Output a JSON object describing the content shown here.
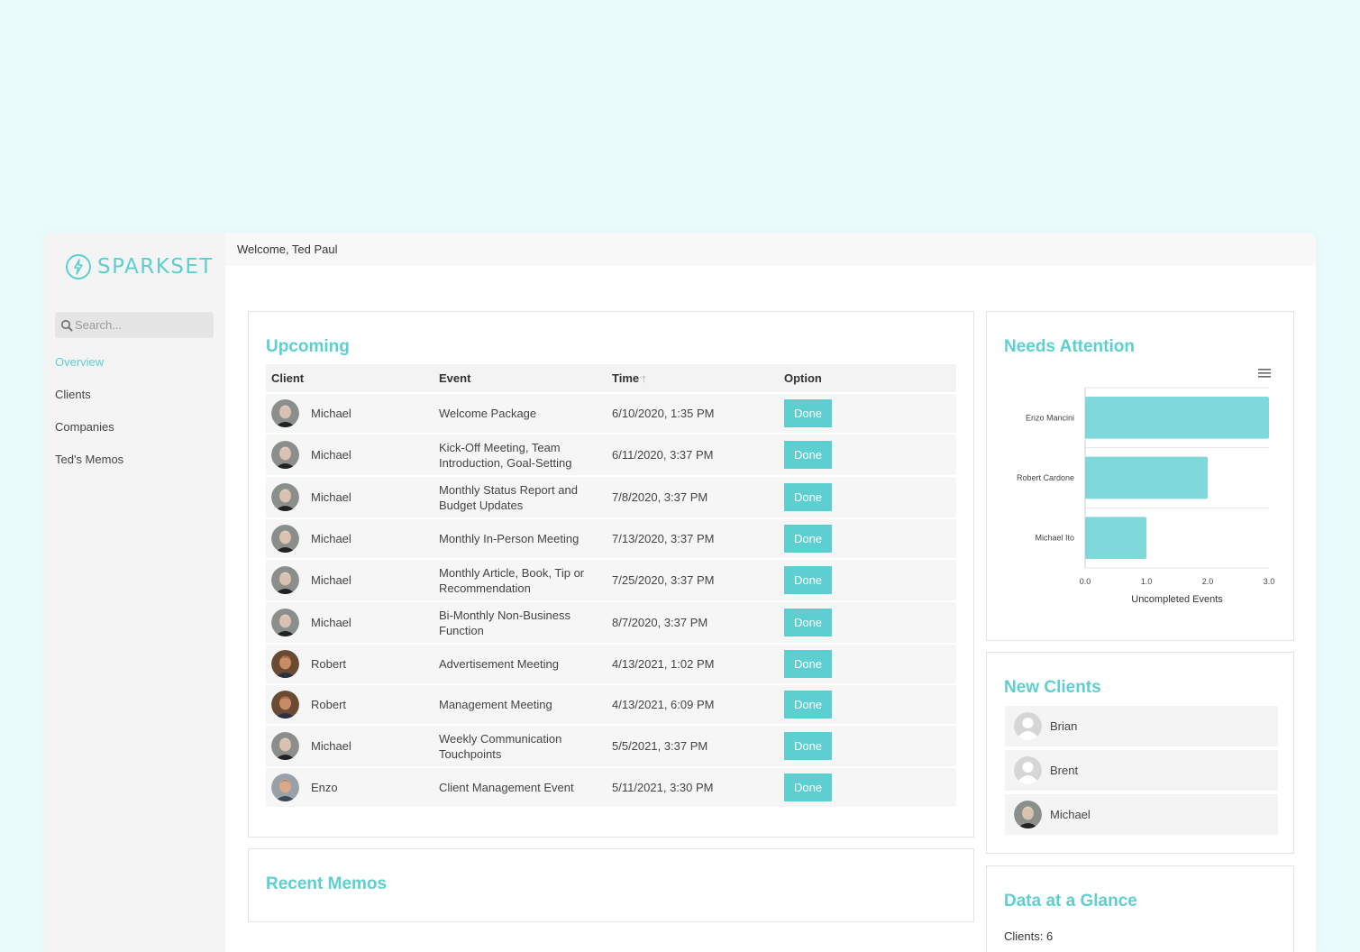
{
  "brand": {
    "name": "SPARKSET",
    "accent": "#5dcfd0"
  },
  "search": {
    "placeholder": "Search..."
  },
  "nav": {
    "items": [
      {
        "label": "Overview",
        "active": true
      },
      {
        "label": "Clients",
        "active": false
      },
      {
        "label": "Companies",
        "active": false
      },
      {
        "label": "Ted's Memos",
        "active": false
      }
    ]
  },
  "header": {
    "welcome": "Welcome, Ted Paul"
  },
  "upcoming": {
    "title": "Upcoming",
    "columns": {
      "client": "Client",
      "event": "Event",
      "time": "Time",
      "option": "Option"
    },
    "sort_icon": "arrow-up-icon",
    "rows": [
      {
        "client": "Michael",
        "event": "Welcome Package",
        "time": "6/10/2020, 1:35 PM",
        "option": "Done"
      },
      {
        "client": "Michael",
        "event": "Kick-Off Meeting, Team Introduction, Goal-Setting",
        "time": "6/11/2020, 3:37 PM",
        "option": "Done"
      },
      {
        "client": "Michael",
        "event": "Monthly Status Report and Budget Updates",
        "time": "7/8/2020, 3:37 PM",
        "option": "Done"
      },
      {
        "client": "Michael",
        "event": "Monthly In-Person Meeting",
        "time": "7/13/2020, 3:37 PM",
        "option": "Done"
      },
      {
        "client": "Michael",
        "event": "Monthly Article, Book, Tip or Recommendation",
        "time": "7/25/2020, 3:37 PM",
        "option": "Done"
      },
      {
        "client": "Michael",
        "event": "Bi-Monthly Non-Business Function",
        "time": "8/7/2020, 3:37 PM",
        "option": "Done"
      },
      {
        "client": "Robert",
        "event": "Advertisement Meeting",
        "time": "4/13/2021, 1:02 PM",
        "option": "Done"
      },
      {
        "client": "Robert",
        "event": "Management Meeting",
        "time": "4/13/2021, 6:09 PM",
        "option": "Done"
      },
      {
        "client": "Michael",
        "event": "Weekly Communication Touchpoints",
        "time": "5/5/2021, 3:37 PM",
        "option": "Done"
      },
      {
        "client": "Enzo",
        "event": "Client Management Event",
        "time": "5/11/2021, 3:30 PM",
        "option": "Done"
      }
    ]
  },
  "recent_memos": {
    "title": "Recent Memos"
  },
  "needs_attention": {
    "title": "Needs Attention"
  },
  "chart_data": {
    "type": "bar",
    "orientation": "horizontal",
    "categories": [
      "Enzo Mancini",
      "Robert Cardone",
      "Michael Ito"
    ],
    "values": [
      3,
      2,
      1
    ],
    "xlabel": "Uncompleted Events",
    "ylabel": "",
    "xlim": [
      0,
      3
    ],
    "xticks": [
      "0.0",
      "1.0",
      "2.0",
      "3.0"
    ],
    "bar_color": "#7fd9da",
    "grid": true
  },
  "new_clients": {
    "title": "New Clients",
    "items": [
      {
        "name": "Brian",
        "avatar": "placeholder"
      },
      {
        "name": "Brent",
        "avatar": "placeholder"
      },
      {
        "name": "Michael",
        "avatar": "photo"
      }
    ]
  },
  "glance": {
    "title": "Data at a Glance",
    "clients_text": "Clients: 6"
  }
}
